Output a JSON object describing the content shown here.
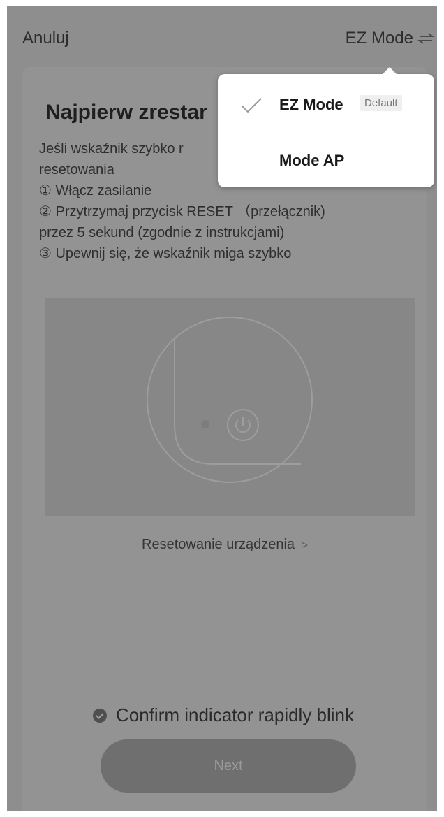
{
  "header": {
    "cancel_label": "Anuluj",
    "mode_label": "EZ Mode"
  },
  "main": {
    "title": "Najpierw zrestar",
    "description_lines": [
      "Jeśli wskaźnik szybko r",
      "resetowania",
      "① Włącz zasilanie",
      "② Przytrzymaj przycisk RESET （przełącznik)",
      "przez 5 sekund (zgodnie z instrukcjami)",
      "③ Upewnij się, że wskaźnik miga szybko"
    ],
    "reset_link_label": "Resetowanie urządzenia",
    "reset_link_chevron": ">",
    "confirm_label": "Confirm indicator rapidly blink",
    "next_label": "Next"
  },
  "dropdown": {
    "items": [
      {
        "label": "EZ Mode",
        "badge": "Default",
        "selected": true
      },
      {
        "label": "Mode AP",
        "selected": false
      }
    ]
  },
  "icons": {
    "swap": "swap-arrows-icon",
    "check": "checkmark-icon",
    "power": "power-icon",
    "confirm": "check-circle-icon"
  },
  "colors": {
    "overlay": "#8e8e8e",
    "button": "#6f6f6f",
    "dropdown_bg": "#ffffff"
  }
}
